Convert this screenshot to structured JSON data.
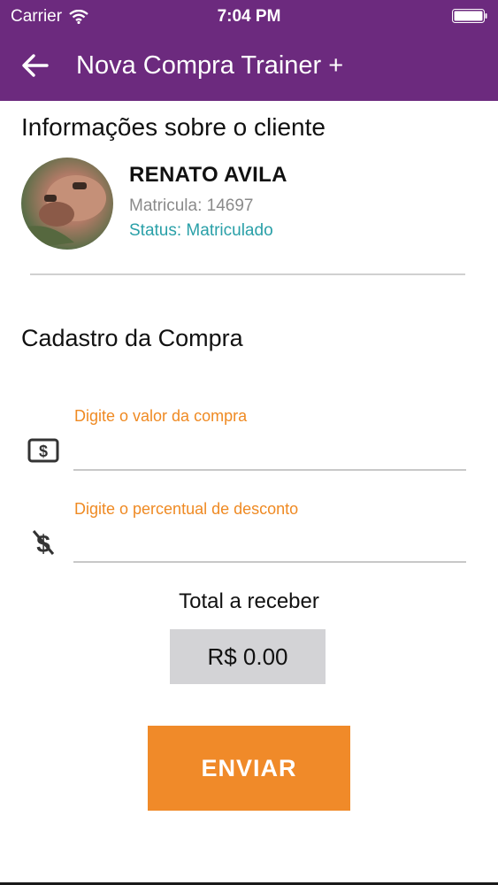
{
  "status_bar": {
    "carrier": "Carrier",
    "time": "7:04 PM",
    "wifi_icon": "wifi-icon",
    "battery_icon": "battery-icon"
  },
  "nav": {
    "back_icon": "arrow-left-icon",
    "title": "Nova Compra Trainer +",
    "color": "#6c2a7e"
  },
  "client": {
    "section_title": "Informações sobre o cliente",
    "name": "RENATO AVILA",
    "registration": "Matricula: 14697",
    "status": "Status: Matriculado",
    "status_color": "#2aa0a8"
  },
  "purchase": {
    "section_title": "Cadastro da Compra",
    "value_field": {
      "label": "Digite o valor da compra",
      "value": "",
      "icon": "dollar-bill-icon"
    },
    "discount_field": {
      "label": "Digite o percentual de desconto",
      "value": "",
      "icon": "no-dollar-icon"
    },
    "label_color": "#ef8a23",
    "total_label": "Total a receber",
    "total_value": "R$ 0.00",
    "submit_label": "ENVIAR",
    "submit_color": "#f08a29"
  }
}
